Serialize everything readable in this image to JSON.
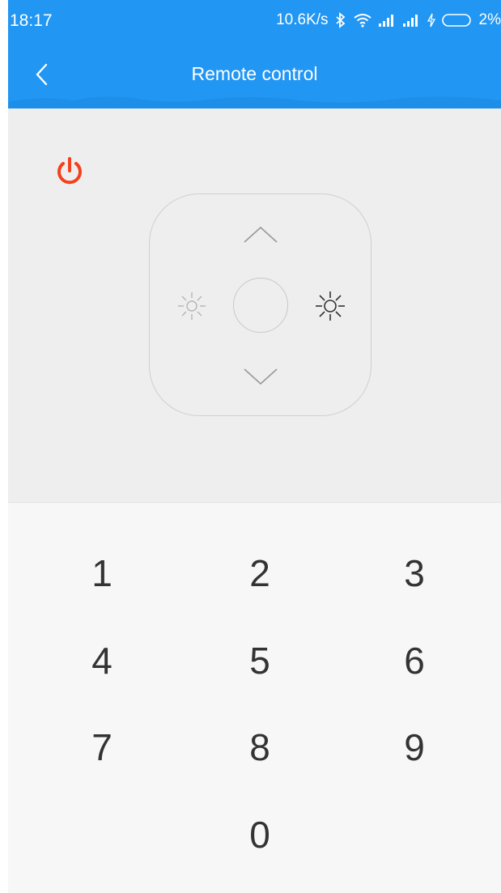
{
  "status_bar": {
    "time": "18:17",
    "net_speed": "10.6K/s",
    "battery": "2%",
    "icons": [
      "bluetooth-icon",
      "wifi-icon",
      "signal-icon",
      "signal-icon",
      "charging-icon",
      "battery-icon"
    ]
  },
  "header": {
    "title": "Remote control",
    "back_icon": "chevron-left-icon"
  },
  "colors": {
    "primary": "#2196f3",
    "power": "#f4401d",
    "panel_bg": "#eeeeee",
    "keypad_bg": "#f7f7f7"
  },
  "controls": {
    "power_icon": "power-icon",
    "up_icon": "chevron-up-icon",
    "down_icon": "chevron-down-icon",
    "brightness_down_icon": "sun-dim-icon",
    "brightness_up_icon": "sun-bright-icon",
    "center_icon": "circle-ok-icon"
  },
  "keypad": {
    "keys": [
      "1",
      "2",
      "3",
      "4",
      "5",
      "6",
      "7",
      "8",
      "9",
      "0"
    ]
  }
}
